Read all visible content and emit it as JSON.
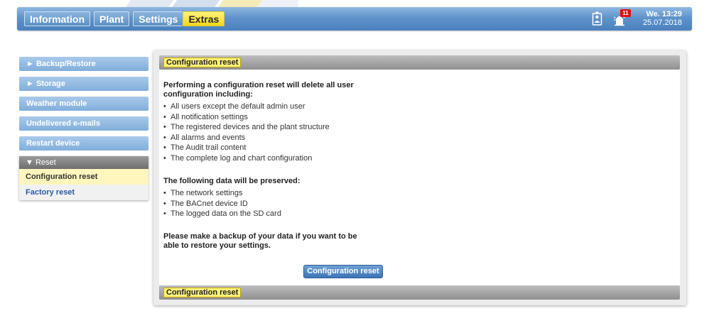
{
  "header": {
    "tabs": [
      {
        "label": "Information"
      },
      {
        "label": "Plant"
      },
      {
        "label": "Settings"
      },
      {
        "label": "Extras"
      }
    ],
    "notifications_count": "11",
    "day_time": "We. 13:29",
    "date": "25.07.2018"
  },
  "sidebar": {
    "buttons": [
      {
        "label": "► Backup/Restore"
      },
      {
        "label": "► Storage"
      },
      {
        "label": "Weather module"
      },
      {
        "label": "Undelivered e-mails"
      },
      {
        "label": "Restart device"
      }
    ],
    "group": {
      "header": "▼ Reset",
      "items": [
        {
          "label": "Configuration reset"
        },
        {
          "label": "Factory reset"
        }
      ]
    }
  },
  "main": {
    "title": "Configuration reset",
    "intro": "Performing a configuration reset will delete all user configuration including:",
    "delete_items": [
      "All users except the default admin user",
      "All notification settings",
      "The registered devices and the plant structure",
      "All alarms and events",
      "The Audit trail content",
      "The complete log and chart configuration"
    ],
    "preserved_heading": "The following data will be preserved:",
    "preserved_items": [
      "The network settings",
      "The BACnet device ID",
      "The logged data on the SD card"
    ],
    "backup_note": "Please make a backup of your data if you want to be able to restore your settings.",
    "button_label": "Configuration reset",
    "footer_title": "Configuration reset"
  },
  "colors": {
    "header_blue": "#4a80bd",
    "active_tab_yellow": "#f1d81c",
    "selected_item_bg": "#fff6bd",
    "link_blue": "#2c5aa0"
  },
  "icons": {
    "user_device": "device-person-icon",
    "alarm": "alarm-bell-icon"
  }
}
